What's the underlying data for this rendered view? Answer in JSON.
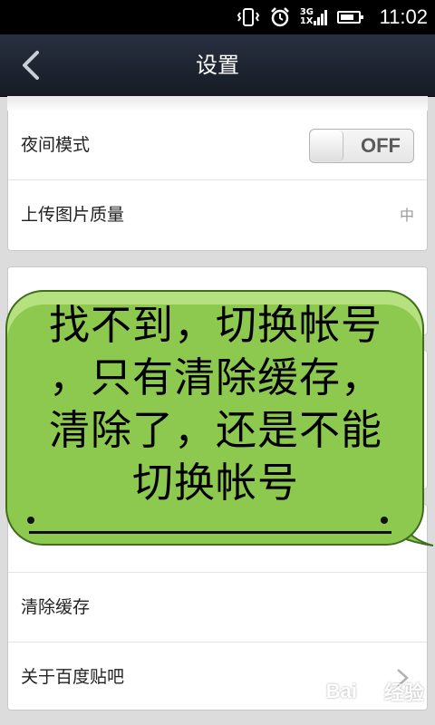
{
  "status_bar": {
    "network": "3G",
    "network_sub": "1X",
    "time": "11:02",
    "icons": [
      "vibrate-icon",
      "alarm-icon",
      "signal-icon",
      "battery-icon"
    ]
  },
  "header": {
    "title": "设置",
    "back_icon": "chevron-left-icon"
  },
  "settings": {
    "night_mode": {
      "label": "夜间模式",
      "toggle_state": "OFF"
    },
    "upload_quality": {
      "label": "上传图片质量",
      "value": "中"
    },
    "clear_cache": {
      "label": "清除缓存"
    },
    "about": {
      "label": "关于百度贴吧"
    }
  },
  "overlay": {
    "lines": [
      "找不到，切换帐号",
      "，只有清除缓存，",
      "清除了，还是不能",
      "切换帐号"
    ]
  },
  "watermark": {
    "text": "Bai",
    "suffix": "经验"
  },
  "colors": {
    "header_bg": "#1f2530",
    "bubble_green": "#8ec94f",
    "bubble_border": "#3f6e1f"
  }
}
